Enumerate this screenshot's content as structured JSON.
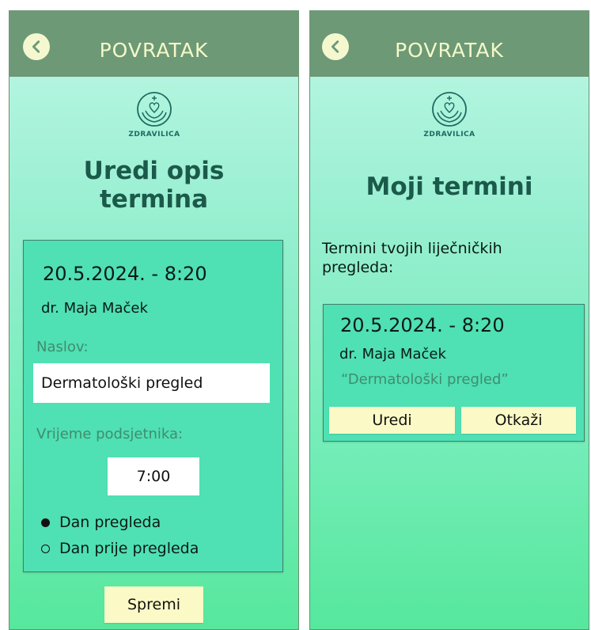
{
  "left_screen": {
    "back_label": "POVRATAK",
    "logo_text": "ZDRAVILICA",
    "title_line1": "Uredi opis",
    "title_line2": "termina",
    "card": {
      "date_time": "20.5.2024. - 8:20",
      "doctor": "dr. Maja Maček",
      "title_label": "Naslov:",
      "title_value": "Dermatološki pregled",
      "reminder_label": "Vrijeme podsjetnika:",
      "reminder_time": "7:00",
      "options": [
        {
          "label": "Dan pregleda",
          "selected": true
        },
        {
          "label": "Dan prije pregleda",
          "selected": false
        }
      ]
    },
    "save_label": "Spremi"
  },
  "right_screen": {
    "back_label": "POVRATAK",
    "logo_text": "ZDRAVILICA",
    "title": "Moji termini",
    "subtitle": "Termini tvojih liječničkih pregleda:",
    "appointment": {
      "date_time": "20.5.2024. - 8:20",
      "doctor": "dr. Maja Maček",
      "description": "“Dermatološki pregled”",
      "edit_label": "Uredi",
      "cancel_label": "Otkaži"
    }
  },
  "colors": {
    "header": "#6d9977",
    "header_text": "#f4f9c8",
    "card": "#4fe0b3",
    "button": "#fbf9c6",
    "heading": "#1b5a4a"
  }
}
